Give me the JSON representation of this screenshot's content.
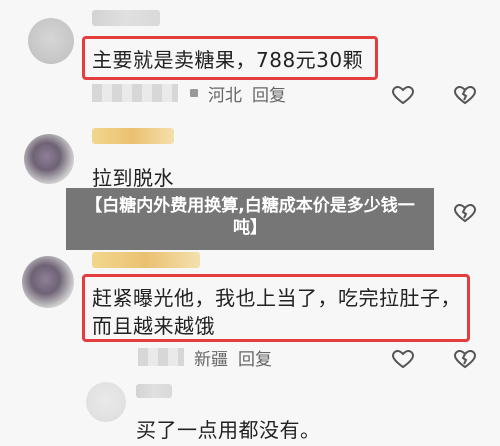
{
  "comments": [
    {
      "text": "主要就是卖糖果，788元30颗",
      "location": "河北",
      "reply": "回复"
    },
    {
      "text": "拉到脱水"
    },
    {
      "text_line1": "赶紧曝光他，我也上当了，吃完拉肚子，",
      "text_line2": "而且越来越饿",
      "location": "新疆",
      "reply": "回复"
    },
    {
      "text": "买了一点用都没有。"
    }
  ],
  "overlay": {
    "title": "【白糖内外费用换算,白糖成本价是多少钱一吨】"
  },
  "icons": {
    "like": "heart-icon",
    "dislike": "broken-heart-icon"
  },
  "colors": {
    "highlight_box": "#e43d3d",
    "overlay_bg": "#525252"
  }
}
